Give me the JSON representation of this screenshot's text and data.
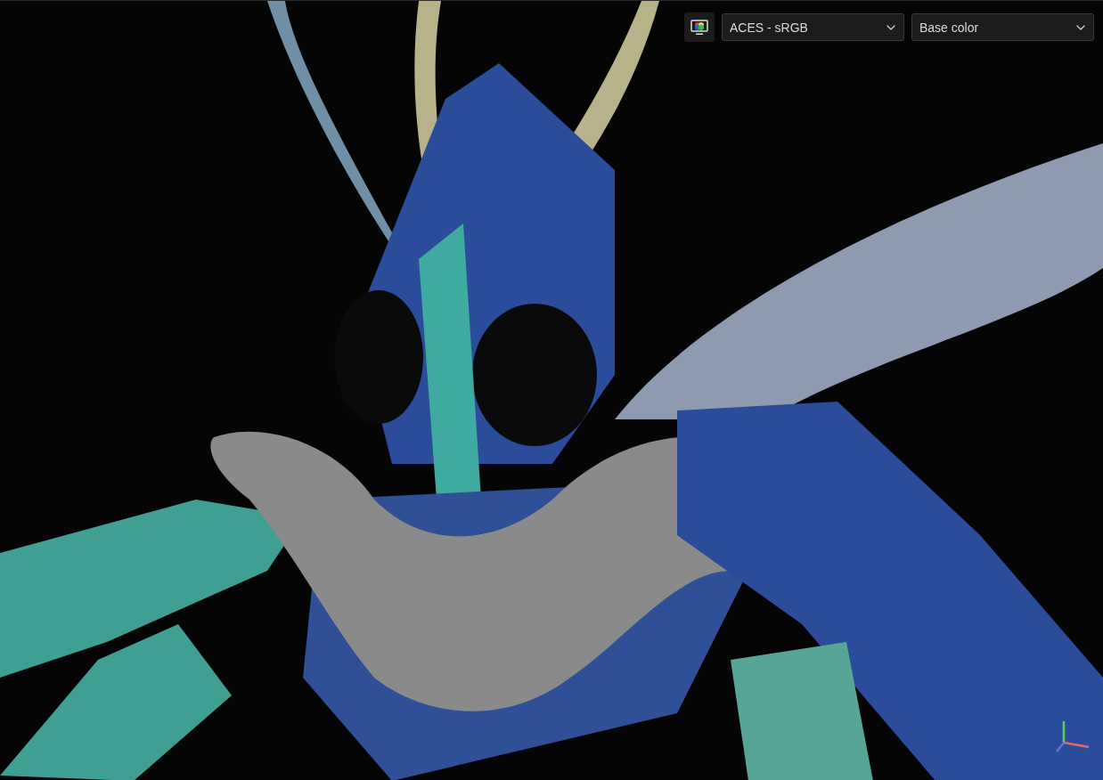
{
  "viewport": {
    "toolbar": {
      "dropdowns": [
        {
          "value": "ACES - sRGB"
        },
        {
          "value": "Base color"
        }
      ]
    }
  }
}
